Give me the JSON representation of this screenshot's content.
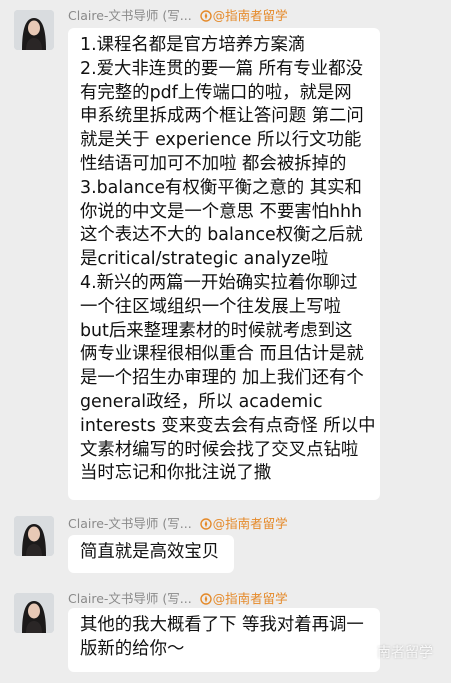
{
  "chat": {
    "messages": [
      {
        "sender": "Claire-文书导师 (写...",
        "tag": "@指南者留学",
        "lines": [
          "1.课程名都是官方培养方案滴",
          "2.爱大非连贯的要一篇 所有专业都没",
          "有完整的pdf上传端口的啦，就是网",
          "申系统里拆成两个框让答问题 第二问",
          "就是关于 experience 所以行文功能",
          "性结语可加可不加啦 都会被拆掉的",
          "3.balance有权衡平衡之意的 其实和",
          "你说的中文是一个意思 不要害怕hhh",
          "这个表达不大的 balance权衡之后就",
          "是critical/strategic analyze啦",
          "4.新兴的两篇一开始确实拉着你聊过",
          "一个往区域组织一个往发展上写啦",
          "but后来整理素材的时候就考虑到这",
          "俩专业课程很相似重合 而且估计是就",
          "是一个招生办审理的 加上我们还有个",
          "general政经，所以 academic",
          "interests 变来变去会有点奇怪 所以中",
          "文素材编写的时候会找了交叉点钻啦",
          "当时忘记和你批注说了撒"
        ]
      },
      {
        "sender": "Claire-文书导师 (写...",
        "tag": "@指南者留学",
        "lines": [
          "简直就是高效宝贝"
        ]
      },
      {
        "sender": "Claire-文书导师 (写...",
        "tag": "@指南者留学",
        "lines": [
          "其他的我大概看了下 等我对着再调一",
          "版新的给你～"
        ]
      }
    ]
  },
  "watermark": "南者留学",
  "colors": {
    "background": "#ededed",
    "bubble": "#ffffff",
    "tag": "#e58a2a",
    "sender": "#8a8a8a"
  }
}
